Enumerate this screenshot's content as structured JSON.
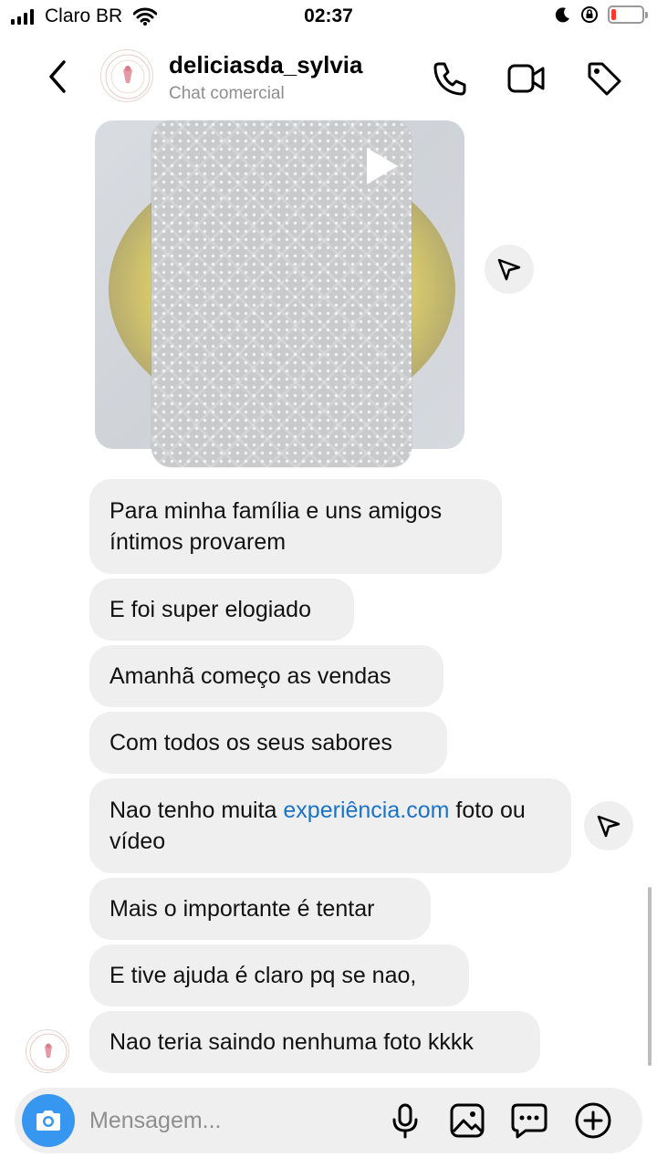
{
  "status_bar": {
    "carrier": "Claro BR",
    "time": "02:37",
    "battery_level": 0.15
  },
  "header": {
    "name": "deliciasda_sylvia",
    "subtitle": "Chat comercial"
  },
  "messages": [
    {
      "text": "Para minha família e uns amigos íntimos provarem"
    },
    {
      "text": "E foi super elogiado"
    },
    {
      "text": "Amanhã começo as vendas"
    },
    {
      "text": "Com todos os seus sabores"
    },
    {
      "text_before": "Nao tenho muita ",
      "link": "experiência.com",
      "text_after": " foto ou vídeo"
    },
    {
      "text": "Mais o importante é tentar"
    },
    {
      "text": "E tive ajuda é claro pq se nao,"
    },
    {
      "text": "Nao teria saindo nenhuma foto kkkk"
    }
  ],
  "composer": {
    "placeholder": "Mensagem..."
  },
  "colors": {
    "accent": "#3797f0",
    "bubble": "#efefef",
    "link": "#1a73c9",
    "battery_low": "#ff3b30"
  },
  "icons": [
    "back-chevron-icon",
    "phone-icon",
    "video-camera-icon",
    "tag-icon",
    "send-icon",
    "camera-icon",
    "microphone-icon",
    "gallery-icon",
    "sticker-icon",
    "plus-icon"
  ]
}
